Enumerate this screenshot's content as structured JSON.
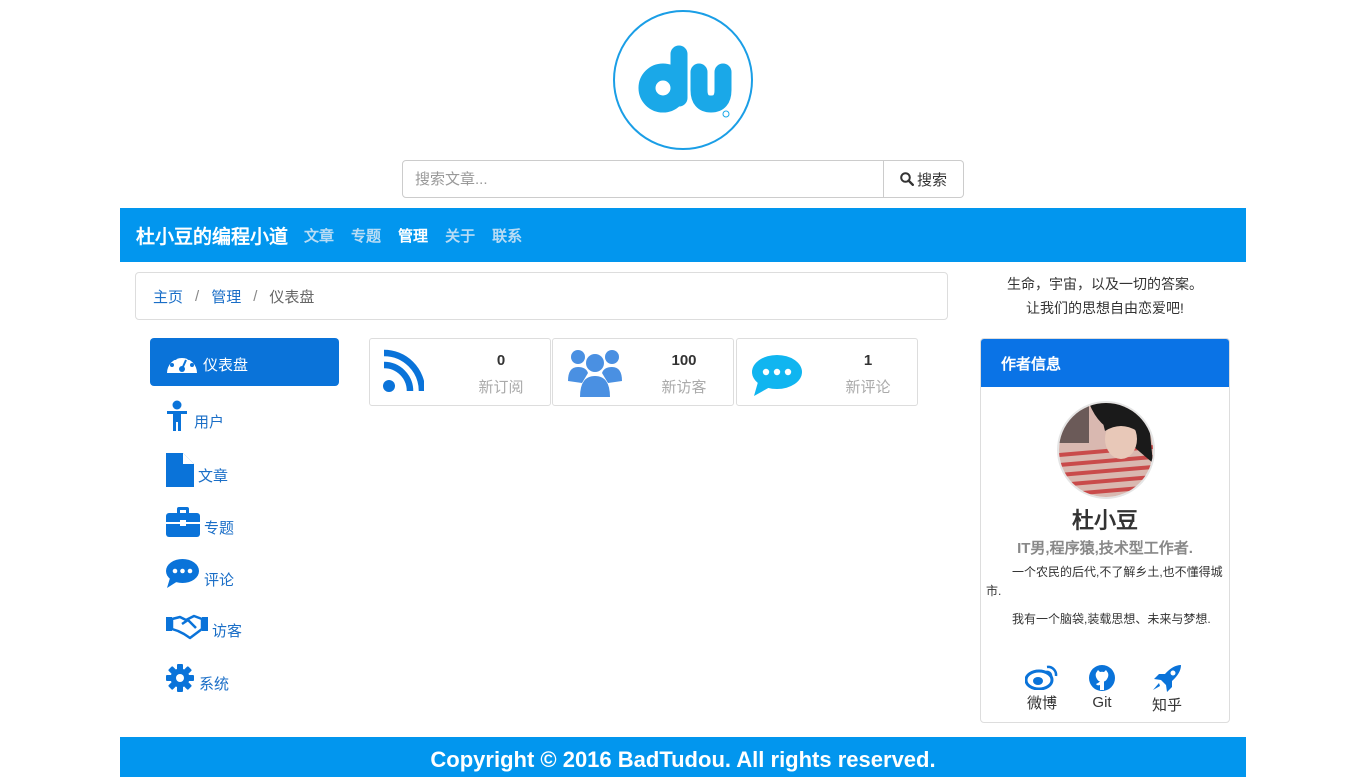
{
  "search": {
    "placeholder": "搜索文章...",
    "button_label": "搜索"
  },
  "navbar": {
    "brand": "杜小豆的编程小道",
    "items": [
      {
        "label": "文章"
      },
      {
        "label": "专题"
      },
      {
        "label": "管理"
      },
      {
        "label": "关于"
      },
      {
        "label": "联系"
      }
    ]
  },
  "breadcrumb": {
    "home": "主页",
    "section": "管理",
    "current": "仪表盘",
    "separator": "/"
  },
  "quote": {
    "line1": "生命，宇宙，以及一切的答案。",
    "line2": "让我们的思想自由恋爱吧!"
  },
  "sidebar": {
    "items": [
      {
        "label": "仪表盘",
        "icon": "dashboard-icon"
      },
      {
        "label": "用户",
        "icon": "user-icon"
      },
      {
        "label": "文章",
        "icon": "file-icon"
      },
      {
        "label": "专题",
        "icon": "briefcase-icon"
      },
      {
        "label": "评论",
        "icon": "comment-icon"
      },
      {
        "label": "访客",
        "icon": "handshake-icon"
      },
      {
        "label": "系统",
        "icon": "gear-icon"
      }
    ]
  },
  "stats": [
    {
      "value": "0",
      "label": "新订阅",
      "icon": "rss-icon",
      "color": "#0a73d9"
    },
    {
      "value": "100",
      "label": "新访客",
      "icon": "users-icon",
      "color": "#4a90e2"
    },
    {
      "value": "1",
      "label": "新评论",
      "icon": "chat-icon",
      "color": "#10b5f0"
    }
  ],
  "author": {
    "header": "作者信息",
    "name": "杜小豆",
    "title": "IT男,程序猿,技术型工作者.",
    "bio1": "一个农民的后代,不了解乡土,也不懂得城市.",
    "bio2": "我有一个脑袋,装载思想、未来与梦想.",
    "social": [
      {
        "label": "微博",
        "icon": "weibo-icon"
      },
      {
        "label": "Git",
        "icon": "github-icon"
      },
      {
        "label": "知乎",
        "icon": "rocket-icon"
      }
    ]
  },
  "footer": {
    "text": "Copyright © 2016 BadTudou. All rights reserved."
  },
  "colors": {
    "primary": "#0296ee",
    "accent": "#0a73d9",
    "link": "#1a6ec7"
  }
}
